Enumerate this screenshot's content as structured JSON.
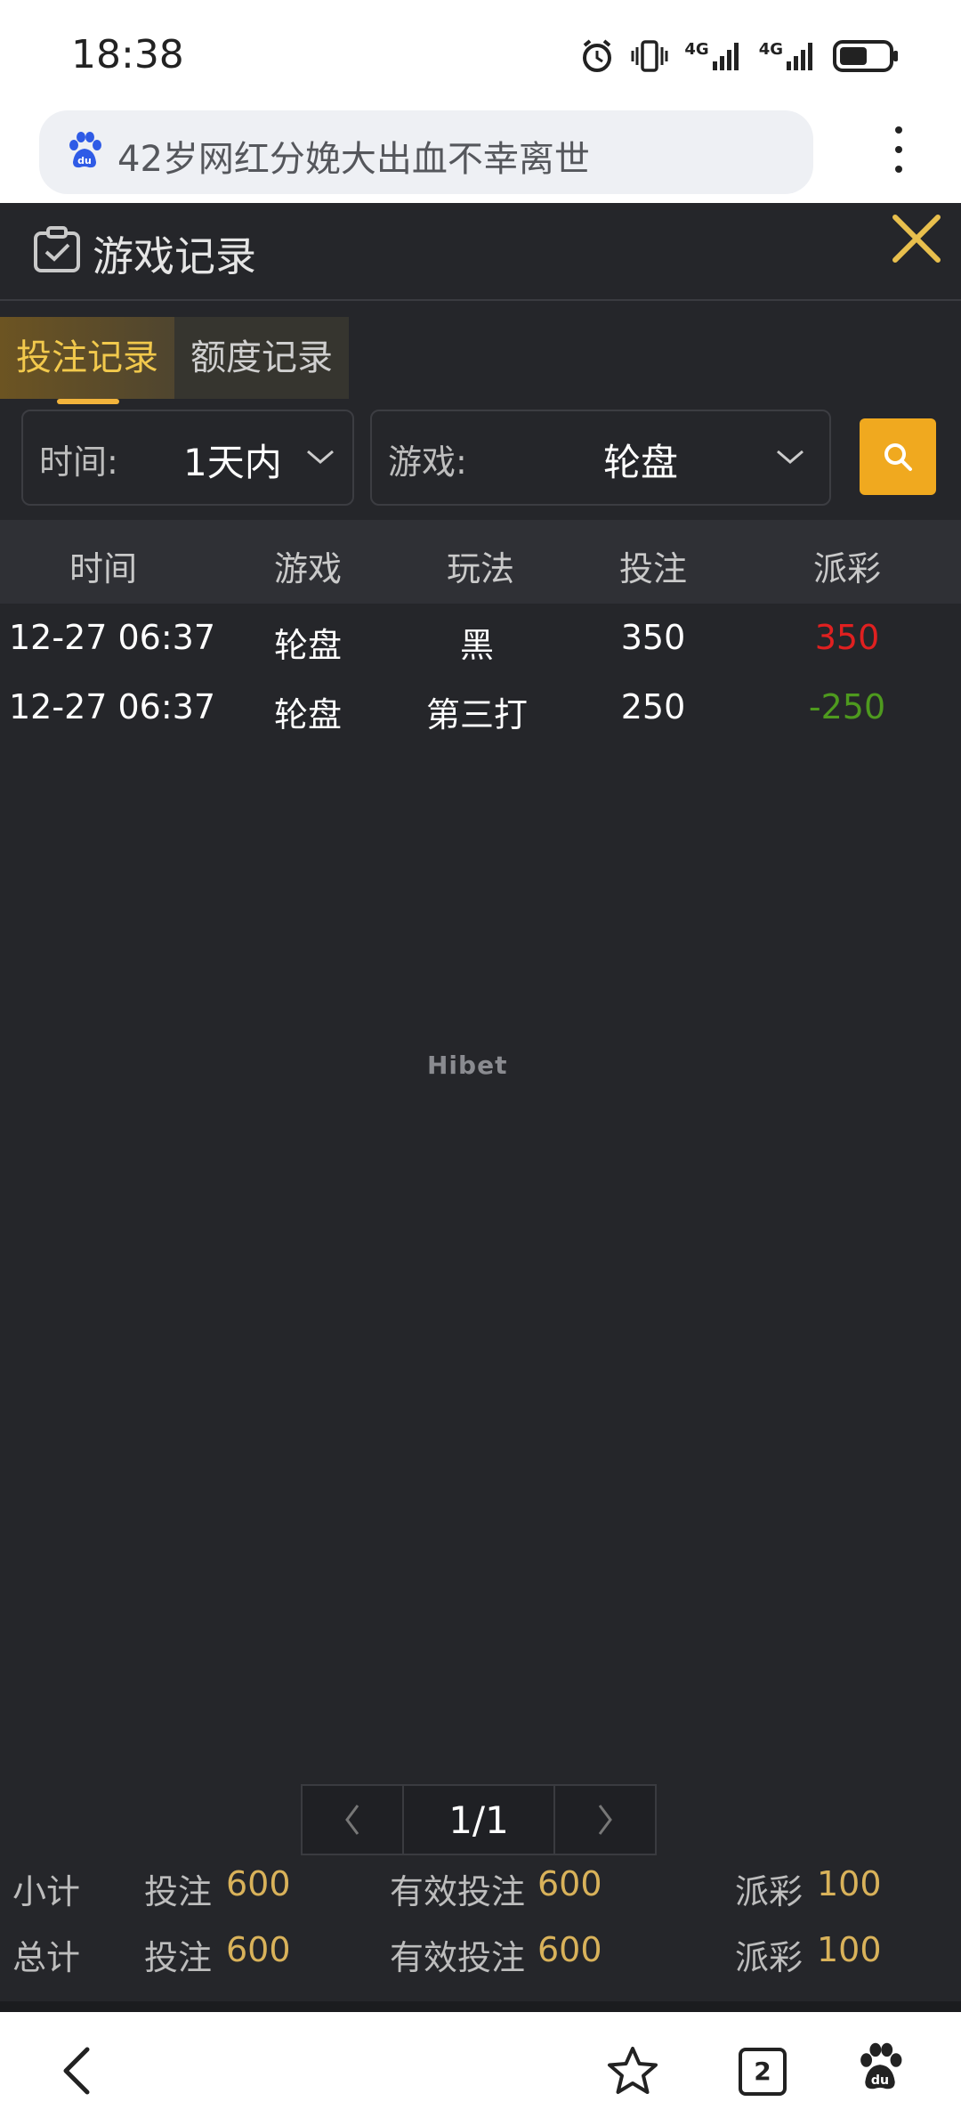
{
  "status": {
    "time": "18:38",
    "network_1": "4G",
    "network_2": "4G"
  },
  "browser": {
    "url_text": "42岁网红分娩大出血不幸离世",
    "tabs_count": "2"
  },
  "modal": {
    "title": "游戏记录"
  },
  "tabs": [
    {
      "label": "投注记录"
    },
    {
      "label": "额度记录"
    }
  ],
  "filters": {
    "time_label": "时间:",
    "time_value": "1天内",
    "game_label": "游戏:",
    "game_value": "轮盘"
  },
  "table": {
    "headers": [
      "时间",
      "游戏",
      "玩法",
      "投注",
      "派彩"
    ],
    "rows": [
      {
        "time": "12-27 06:37",
        "game": "轮盘",
        "play": "黑",
        "bet": "350",
        "payout": "350"
      },
      {
        "time": "12-27 06:37",
        "game": "轮盘",
        "play": "第三打",
        "bet": "250",
        "payout": "-250"
      }
    ]
  },
  "watermark": "Hibet",
  "pagination": {
    "page": "1/1"
  },
  "summary": {
    "subtotal": {
      "label": "小计",
      "bet_label": "投注",
      "bet": "600",
      "valid_label": "有效投注",
      "valid": "600",
      "payout_label": "派彩",
      "payout": "100"
    },
    "total": {
      "label": "总计",
      "bet_label": "投注",
      "bet": "600",
      "valid_label": "有效投注",
      "valid": "600",
      "payout_label": "派彩",
      "payout": "100"
    }
  },
  "colors": {
    "accent": "#f0a91f",
    "tab_active_text": "#f2c94c",
    "win": "#e02020",
    "loss": "#4e9a1e",
    "background": "#25262a"
  }
}
